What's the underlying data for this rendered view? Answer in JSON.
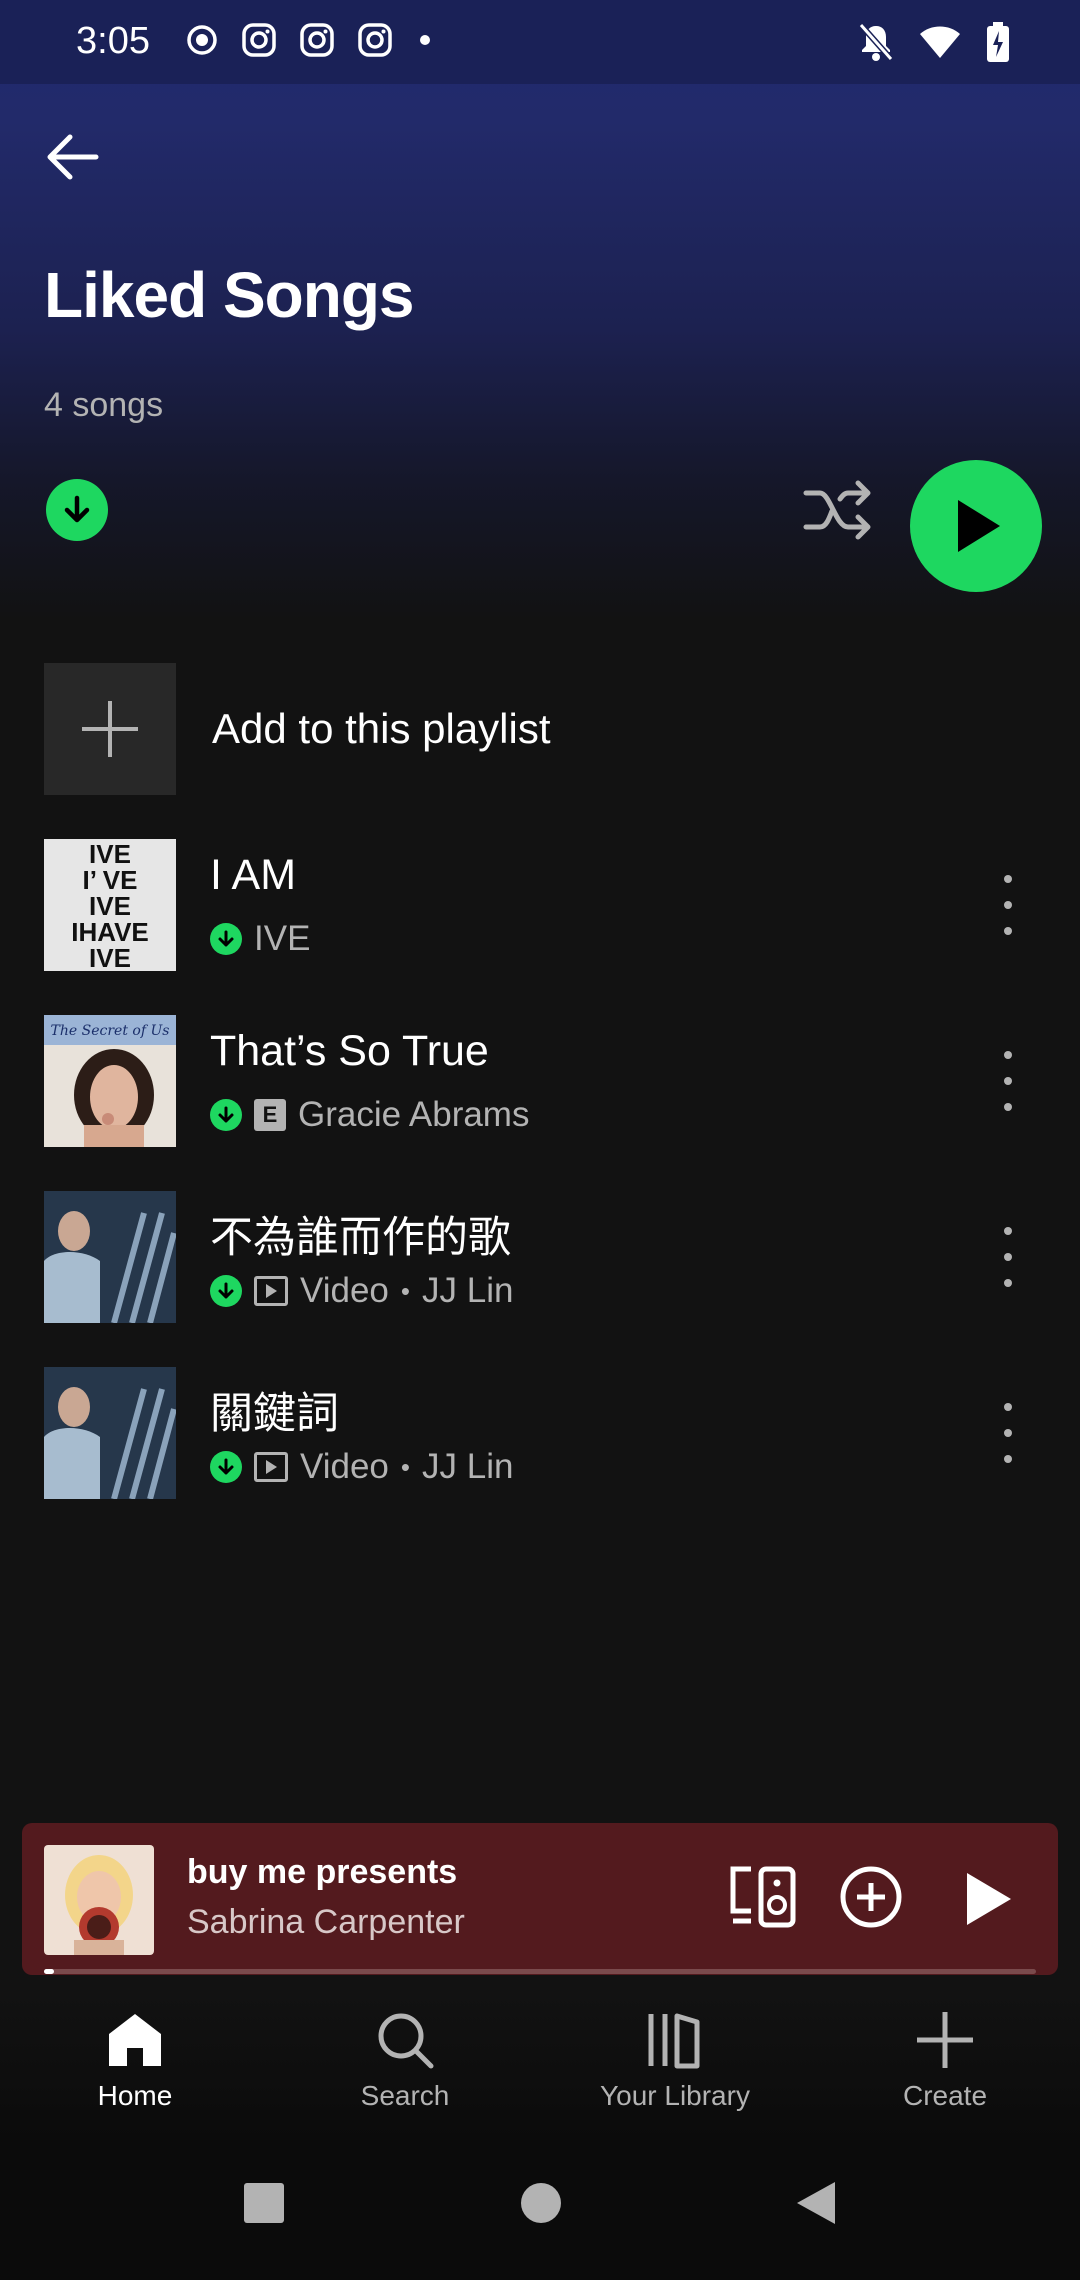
{
  "status_bar": {
    "time": "3:05"
  },
  "header": {
    "title": "Liked Songs",
    "song_count": "4 songs"
  },
  "add_row": {
    "label": "Add to this playlist"
  },
  "tracks": [
    {
      "title": "I AM",
      "artist": "IVE",
      "explicit": false,
      "type": ""
    },
    {
      "title": "That’s So True",
      "artist": "Gracie Abrams",
      "explicit": true,
      "type": ""
    },
    {
      "title": "不為誰而作的歌",
      "artist": "JJ Lin",
      "explicit": false,
      "type": "Video"
    },
    {
      "title": "關鍵詞",
      "artist": "JJ Lin",
      "explicit": false,
      "type": "Video"
    }
  ],
  "track_meta": {
    "explicit_badge": "E",
    "separator": "•",
    "track3_type": "Video",
    "track4_type": "Video"
  },
  "art": {
    "ive_text": [
      "IVE",
      "I’ VE",
      "IVE",
      "IHAVE",
      "IVE"
    ],
    "gracie_text": "The Secret of Us"
  },
  "mini_player": {
    "title": "buy me presents",
    "artist": "Sabrina Carpenter",
    "progress": 0.01
  },
  "bottom_nav": {
    "items": [
      {
        "label": "Home",
        "icon": "home-icon",
        "active": true
      },
      {
        "label": "Search",
        "icon": "search-icon",
        "active": false
      },
      {
        "label": "Your Library",
        "icon": "library-icon",
        "active": false
      },
      {
        "label": "Create",
        "icon": "plus-icon",
        "active": false
      }
    ]
  },
  "colors": {
    "accent": "#1ed760",
    "header_top": "#1f2870",
    "background": "#121212",
    "mini_player_bg": "#531a1e"
  }
}
